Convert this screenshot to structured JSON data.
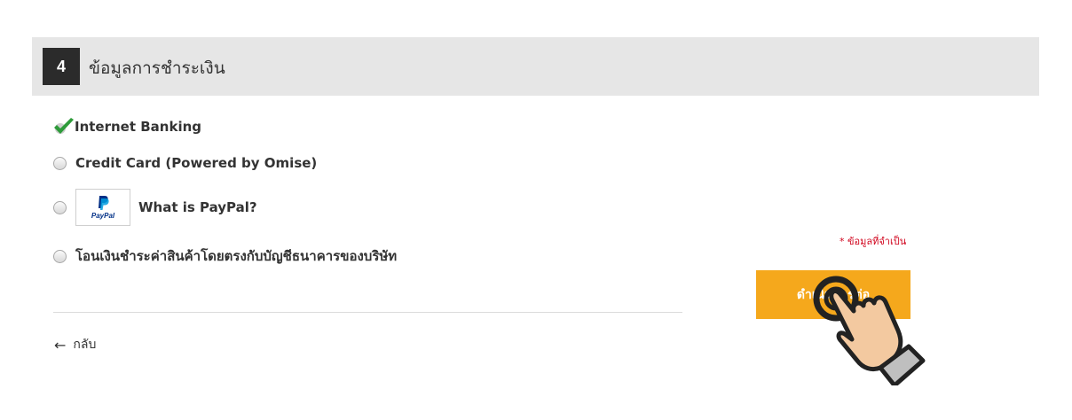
{
  "section": {
    "step_number": "4",
    "title": "ข้อมูลการชำระเงิน"
  },
  "payment_options": [
    {
      "label": "Internet Banking",
      "selected": true
    },
    {
      "label": "Credit Card (Powered by Omise)",
      "selected": false
    },
    {
      "label": "What is PayPal?",
      "selected": false,
      "logo_text": "PayPal"
    },
    {
      "label": "โอนเงินชำระค่าสินค้าโดยตรงกับบัญชีธนาคารของบริษัท",
      "selected": false
    }
  ],
  "back_link": {
    "label": "กลับ"
  },
  "required_note": "* ข้อมูลที่จำเป็น",
  "submit_button": {
    "label": "ดำเนินการต่อ"
  },
  "colors": {
    "header_bg": "#e6e6e6",
    "step_badge_bg": "#2b2b2b",
    "button_bg": "#f5a81c",
    "check_green": "#2e9b3a",
    "required_red": "#d0021b"
  }
}
